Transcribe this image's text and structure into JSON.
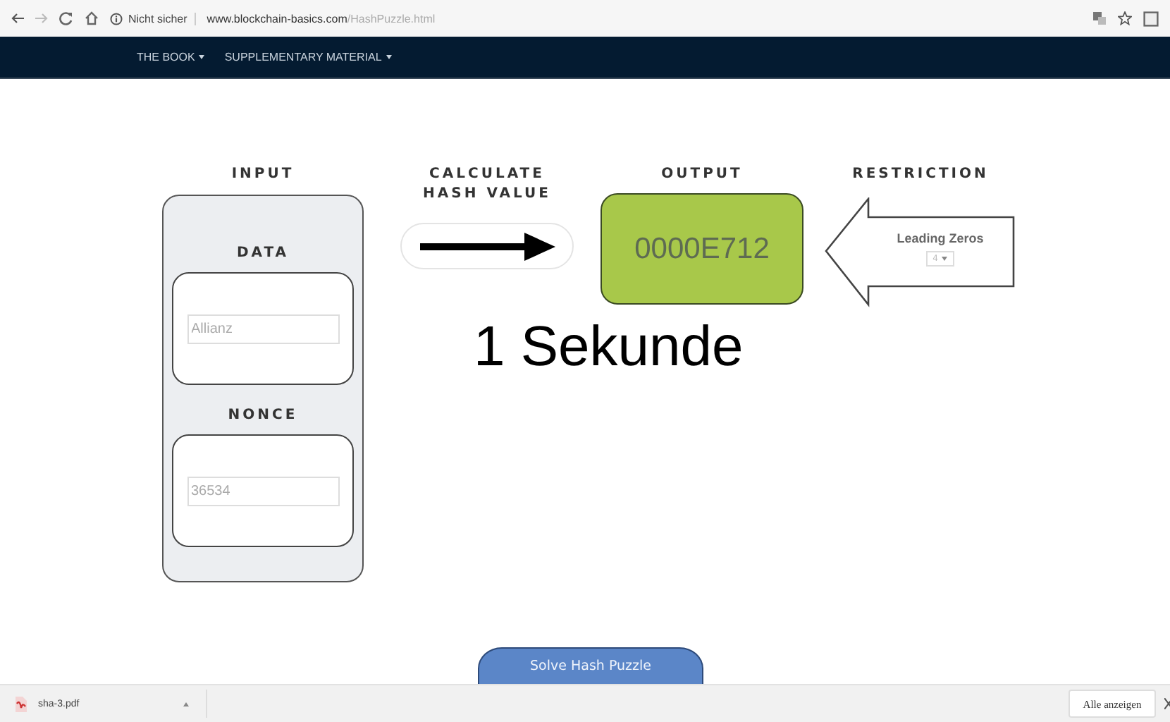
{
  "browser": {
    "address": {
      "security": "Nicht sicher",
      "domain": "www.blockchain-basics.com",
      "path": "/HashPuzzle.html"
    }
  },
  "nav": {
    "items": [
      {
        "label": "THE BOOK"
      },
      {
        "label": "SUPPLEMENTARY MATERIAL"
      }
    ]
  },
  "puzzle": {
    "input": {
      "heading": "INPUT",
      "fields": [
        {
          "label": "DATA",
          "value": "Allianz"
        },
        {
          "label": "NONCE",
          "value": "36534"
        }
      ]
    },
    "calculate": {
      "heading": "CALCULATE HASH VALUE"
    },
    "output": {
      "heading": "OUTPUT",
      "value": "0000E712"
    },
    "restriction": {
      "heading": "RESTRICTION",
      "label": "Leading Zeros",
      "value": "4"
    }
  },
  "overlay_text": "1 Sekunde",
  "solve_button": "Solve Hash Puzzle",
  "downloads": {
    "items": [
      {
        "name": "sha-3.pdf"
      }
    ],
    "show_all": "Alle anzeigen"
  }
}
